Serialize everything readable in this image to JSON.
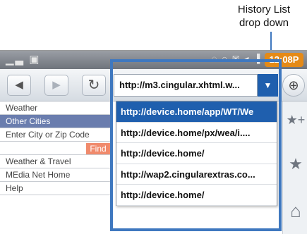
{
  "annotation": {
    "line1": "History List",
    "line2": "drop down"
  },
  "statusbar": {
    "left_icons": "▁▃ ▣",
    "right_icons": "◌ ○ ✉ ◂ ▐",
    "time": "12:08P",
    "clock_color": "#e58a17"
  },
  "toolbar": {
    "back_icon": "◀",
    "forward_icon": "▶",
    "refresh_icon": "↻",
    "url_value": "http://m3.cingular.xhtml.w...",
    "dropdown_icon": "▼",
    "zoom_icon": "⊕"
  },
  "page": {
    "items": [
      "Weather",
      "Other Cities",
      "Enter City or Zip Code",
      "",
      "Weather & Travel",
      "MEdia Net Home",
      "Help"
    ],
    "find_label": "Find"
  },
  "history": {
    "items": [
      "http://device.home/app/WT/We",
      "http://device.home/px/wea/i....",
      "http://device.home/",
      "http://wap2.cingularextras.co...",
      "http://device.home/"
    ],
    "selected_color": "#1f5fae"
  },
  "sidebar": {
    "add_favorite_icon": "★+",
    "favorites_icon": "★",
    "home_icon": "⌂"
  },
  "colors": {
    "highlight_frame": "#3f78bf"
  }
}
